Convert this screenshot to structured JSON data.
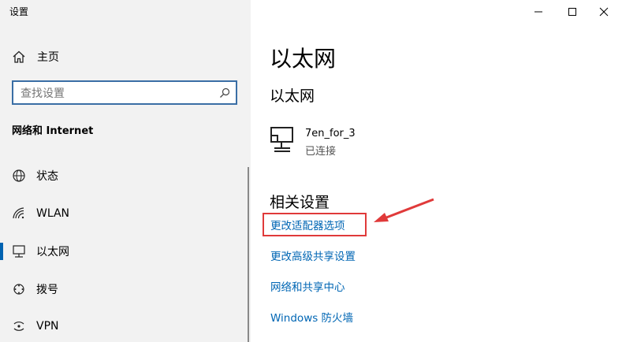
{
  "window": {
    "title": "设置",
    "minimize_icon": "minimize-icon",
    "maximize_icon": "maximize-icon",
    "close_icon": "close-icon"
  },
  "sidebar": {
    "home_label": "主页",
    "home_icon": "home-icon",
    "search": {
      "placeholder": "查找设置",
      "icon": "search-icon"
    },
    "section_title": "网络和 Internet",
    "items": [
      {
        "label": "状态",
        "icon": "globe-icon",
        "selected": false
      },
      {
        "label": "WLAN",
        "icon": "wifi-icon",
        "selected": false
      },
      {
        "label": "以太网",
        "icon": "ethernet-icon",
        "selected": true
      },
      {
        "label": "拨号",
        "icon": "dialup-icon",
        "selected": false
      },
      {
        "label": "VPN",
        "icon": "vpn-icon",
        "selected": false
      }
    ]
  },
  "main": {
    "page_title": "以太网",
    "section_title": "以太网",
    "network": {
      "name": "7en_for_3",
      "status": "已连接",
      "icon": "network-pc-icon"
    },
    "related_title": "相关设置",
    "links": [
      {
        "label": "更改适配器选项"
      },
      {
        "label": "更改高级共享设置"
      },
      {
        "label": "网络和共享中心"
      },
      {
        "label": "Windows 防火墙"
      }
    ]
  },
  "annotation": {
    "color": "#e03a3a"
  },
  "colors": {
    "accent": "#0063b1",
    "link": "#0066b4",
    "sidebar_bg": "#f2f2f2"
  }
}
